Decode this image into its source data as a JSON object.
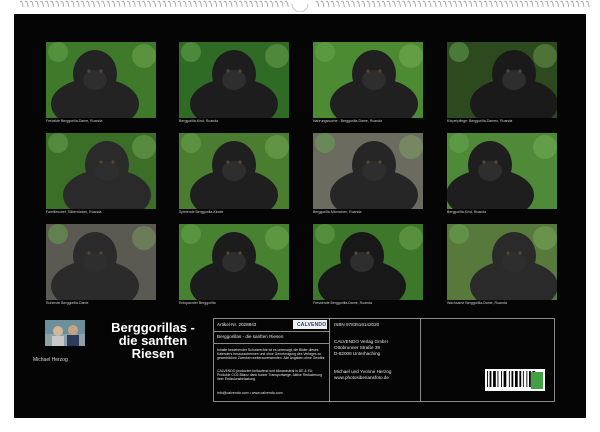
{
  "calendar": {
    "title": "Berggorillas - die sanften Riesen",
    "author": "Michael Herzog"
  },
  "captions": [
    "Freiwilde Berggorilla-Dame, Ruanda",
    "Berggorilla-Kind, Ruanda",
    "Nahrungssuche - Berggorilla-Dame, Ruanda",
    "Körperpflege: Berggorilla-Damen, Ruanda",
    "Familienchef, Silberrücken, Ruanda",
    "Spielende Berggorilla-Kinder",
    "Berggorilla-Männchen, Ruanda",
    "Berggorilla-Kind, Ruanda",
    "Ruhende Berggorilla-Dame",
    "Entspannter Berggorilla",
    "Fressende Berggorilla-Dame, Ruanda",
    "Wachsame Berggorilla-Dame, Ruanda"
  ],
  "info": {
    "article_no": "Artikel-Nr. 2028843",
    "publisher_logo": "CALVENDO",
    "subtitle": "Berggorillas - die sanften Riesen",
    "isbn": "ISBN 9783516142020",
    "publisher_name": "CALVENDO Verlag GmbH",
    "publisher_street": "Ottobrunner Straße 39",
    "publisher_city": "D-82008 Unterhaching",
    "legal_1": "Inhalte bestehender Schutzrechte ist es untersagt, die Bilder dieses Kalenders herauszutrennen und ohne Genehmigung des Verlages zu gewerblichen Zwecken weiterzuverwenden. Alle Angaben ohne Gewähr.",
    "legal_2": "CALVENDO produziert fortlaufend und klimaneutral in DE & EU. Produkte CO2-Bilanz dank kurzer Transportwege. Aktive Reduzierung ihrer Emissionsbelastung.",
    "contact": "info@calvendo.com  •  www.calvendo.com",
    "authors_line": "Michael und Yvonne Herzog",
    "authors_url": "www.photosiberiansfoto.de"
  },
  "colors": {
    "sheet": "#050505",
    "foliage": "#3f7a2a",
    "fur": "#1c1c1c",
    "brand": "#1d3f77"
  }
}
